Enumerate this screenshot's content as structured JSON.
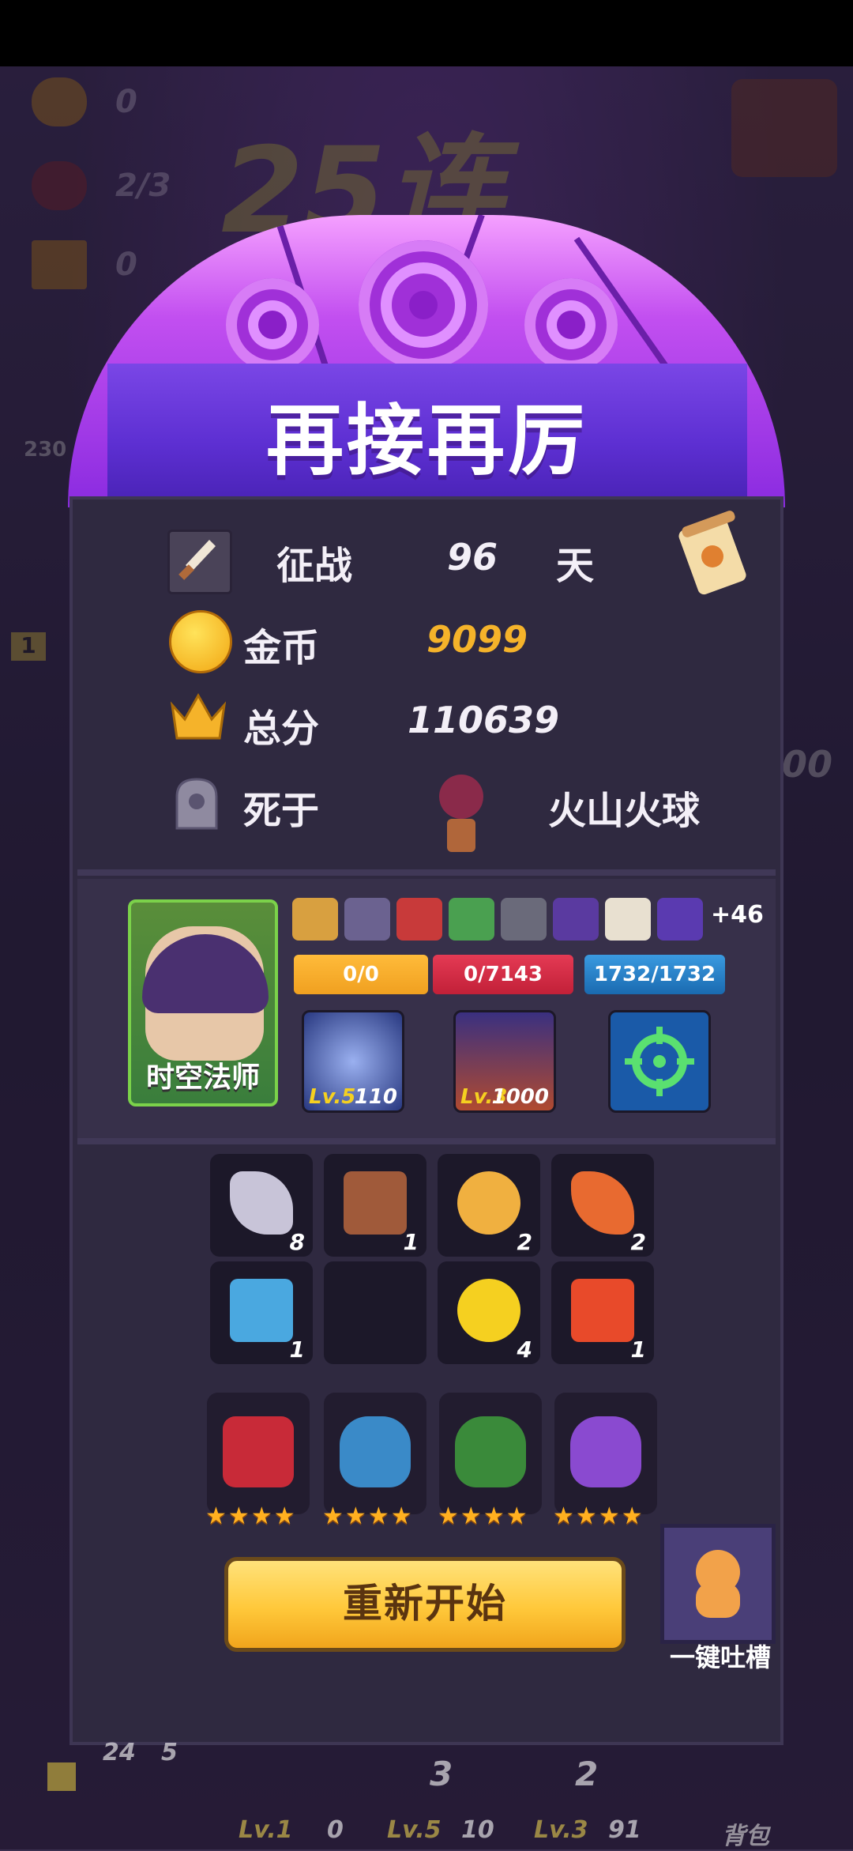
{
  "background": {
    "hud": [
      {
        "icon": "coin-icon",
        "value": "0"
      },
      {
        "icon": "demon-icon",
        "value": "2/3"
      },
      {
        "icon": "crown-icon",
        "value": "0"
      }
    ],
    "streak_text": "25连击",
    "side_badge_1": "230",
    "side_badge_2": "1",
    "side_badge_3": "00"
  },
  "dialog": {
    "title": "再接再厉",
    "stats": {
      "campaign_label": "征战",
      "campaign_value": "96",
      "campaign_unit": "天",
      "gold_label": "金币",
      "gold_value": "9099",
      "score_label": "总分",
      "score_value": "110639",
      "death_label": "死于",
      "death_cause": "火山火球"
    },
    "hero": {
      "name": "时空法师",
      "extra_items": "+46",
      "shield_bar": "0/0",
      "health_bar": "0/7143",
      "mana_bar": "1732/1732",
      "skills": [
        {
          "icon": "vortex-icon",
          "level": "Lv.5",
          "value": "110"
        },
        {
          "icon": "bird-portal-icon",
          "level": "Lv.3",
          "value": "1000"
        },
        {
          "icon": "target-icon",
          "level": "",
          "value": ""
        }
      ]
    },
    "inventory": [
      {
        "icon": "cleaver-icon",
        "count": "8"
      },
      {
        "icon": "hourglass-icon",
        "count": "1"
      },
      {
        "icon": "pie-icon",
        "count": "2"
      },
      {
        "icon": "dagger-icon",
        "count": "2"
      },
      {
        "icon": "drink-icon",
        "count": "1"
      },
      {
        "icon": "empty-slot",
        "count": ""
      },
      {
        "icon": "lemon-icon",
        "count": "4"
      },
      {
        "icon": "gold-hourglass-icon",
        "count": "1"
      }
    ],
    "pets": [
      {
        "icon": "barrel-pet-icon",
        "stars": 4
      },
      {
        "icon": "blue-golem-pet-icon",
        "stars": 4
      },
      {
        "icon": "green-knight-pet-icon",
        "stars": 4
      },
      {
        "icon": "purple-ghost-pet-icon",
        "stars": 4
      }
    ],
    "restart_label": "重新开始",
    "feedback_label": "一键吐槽"
  },
  "bottom_bar": {
    "items": [
      {
        "level": "Lv.1",
        "value": "0"
      },
      {
        "level": "Lv.5",
        "value": "10"
      },
      {
        "level": "Lv.3",
        "value": "91"
      }
    ],
    "numbers": [
      "24",
      "5",
      "3",
      "2"
    ],
    "bag_label": "背包"
  },
  "colors": {
    "panel": "#2f2940",
    "title_banner": "#5d2fd2",
    "gold_text": "#f5b32a",
    "restart_button": "#ffc83a",
    "shield_bar": "#f0a020",
    "health_bar": "#d42a44",
    "mana_bar": "#2a8ad0"
  }
}
